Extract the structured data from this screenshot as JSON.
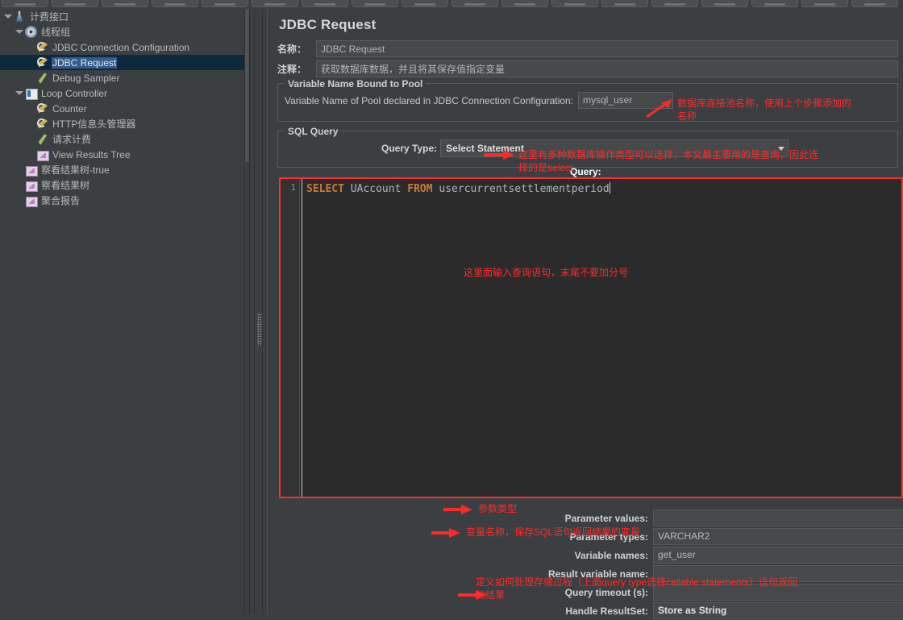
{
  "toolbar": {
    "button_count": 18
  },
  "tree": {
    "items": [
      {
        "label": "计费接口",
        "icon": "flask-icon",
        "indent": 0,
        "twisty": "open",
        "selected": false
      },
      {
        "label": "线程组",
        "icon": "gear-icon",
        "indent": 1,
        "twisty": "open",
        "selected": false
      },
      {
        "label": "JDBC Connection Configuration",
        "icon": "config-icon",
        "indent": 2,
        "twisty": "none",
        "selected": false
      },
      {
        "label": "JDBC Request",
        "icon": "config-icon",
        "indent": 2,
        "twisty": "none",
        "selected": true
      },
      {
        "label": "Debug Sampler",
        "icon": "pen-icon",
        "indent": 2,
        "twisty": "none",
        "selected": false
      },
      {
        "label": "Loop Controller",
        "icon": "loop-icon",
        "indent": 1,
        "twisty": "open",
        "selected": false
      },
      {
        "label": "Counter",
        "icon": "config-icon",
        "indent": 2,
        "twisty": "none",
        "selected": false
      },
      {
        "label": "HTTP信息头管理器",
        "icon": "config-icon",
        "indent": 2,
        "twisty": "none",
        "selected": false
      },
      {
        "label": "请求计费",
        "icon": "pen-icon",
        "indent": 2,
        "twisty": "none",
        "selected": false
      },
      {
        "label": "View Results Tree",
        "icon": "chart-icon",
        "indent": 2,
        "twisty": "none",
        "selected": false
      },
      {
        "label": "察看结果树-true",
        "icon": "chart-icon",
        "indent": 1,
        "twisty": "none",
        "selected": false
      },
      {
        "label": "察看结果树",
        "icon": "chart-icon",
        "indent": 1,
        "twisty": "none",
        "selected": false
      },
      {
        "label": "聚合报告",
        "icon": "chart-icon",
        "indent": 1,
        "twisty": "none",
        "selected": false
      }
    ]
  },
  "main": {
    "title": "JDBC Request",
    "name_label": "名称：",
    "name_value": "JDBC Request",
    "comment_label": "注释：",
    "comment_value": "获取数据库数据，并且将其保存值指定变量",
    "pool_group_title": "Variable Name Bound to Pool",
    "pool_caption": "Variable Name of Pool declared in JDBC Connection Configuration:",
    "pool_value": "mysql_user",
    "sql_group_title": "SQL Query",
    "query_type_label": "Query Type:",
    "query_type_value": "Select Statement",
    "query_caption": "Query:",
    "sql_line_number": "1",
    "sql_keyword_1": "SELECT",
    "sql_ident_1": "UAccount",
    "sql_keyword_2": "FROM",
    "sql_ident_2": "usercurrentsettlementperiod",
    "fields": [
      {
        "label": "Parameter values:",
        "value": "",
        "bold": false,
        "dropdown": false
      },
      {
        "label": "Parameter types:",
        "value": "VARCHAR2",
        "bold": false,
        "dropdown": false
      },
      {
        "label": "Variable names:",
        "value": "get_user",
        "bold": false,
        "dropdown": false
      },
      {
        "label": "Result variable name:",
        "value": "",
        "bold": false,
        "dropdown": false
      },
      {
        "label": "Query timeout (s):",
        "value": "",
        "bold": false,
        "dropdown": false
      },
      {
        "label": "Handle ResultSet:",
        "value": "Store as String",
        "bold": true,
        "dropdown": true
      }
    ]
  },
  "annotations": {
    "pool": "数据库连接池名称，使用上个步骤添加的\n名称",
    "query_type": "这里有多种数据库操作类型可以选择，本文最主要用的是查询，因此选\n择的是",
    "query_type_mono": "select",
    "sql_body": "这里面输入查询语句，末尾不要加分号",
    "param_types": "参数类型",
    "variable_names": "变量名称，保存SQL语句返回结果的变量",
    "handle_resultset_a": "定义如何处理存储过程（上面",
    "handle_resultset_b": "query type",
    "handle_resultset_c": "选择",
    "handle_resultset_d": "callable statements",
    "handle_resultset_e": "）语句返回",
    "handle_resultset_f": "的结果"
  },
  "colors": {
    "annotation_red": "#ff2a2a",
    "selection_blue": "#2f5d8f",
    "panel_bg": "#3c3f41",
    "editor_bg": "#2b2b2b",
    "sql_keyword": "#cc7832"
  }
}
